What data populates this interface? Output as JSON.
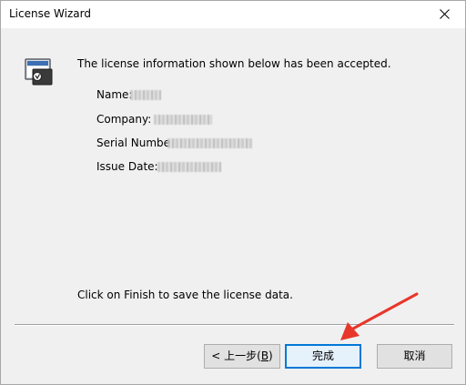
{
  "window": {
    "title": "License Wizard"
  },
  "content": {
    "headline": "The license information shown below has been accepted.",
    "fields": [
      {
        "label": "Name:"
      },
      {
        "label": "Company:"
      },
      {
        "label": "Serial Numbe"
      },
      {
        "label": "Issue Date:"
      }
    ],
    "finish_hint": "Click on Finish to save the license data."
  },
  "buttons": {
    "back": {
      "prefix": "< 上一步(",
      "mnemonic": "B",
      "suffix": ")"
    },
    "finish": "完成",
    "cancel": "取消"
  },
  "icons": {
    "close": "close-icon",
    "wizard": "license-wizard-icon"
  },
  "colors": {
    "accent": "#0078d7",
    "annotation": "#e8362b"
  }
}
